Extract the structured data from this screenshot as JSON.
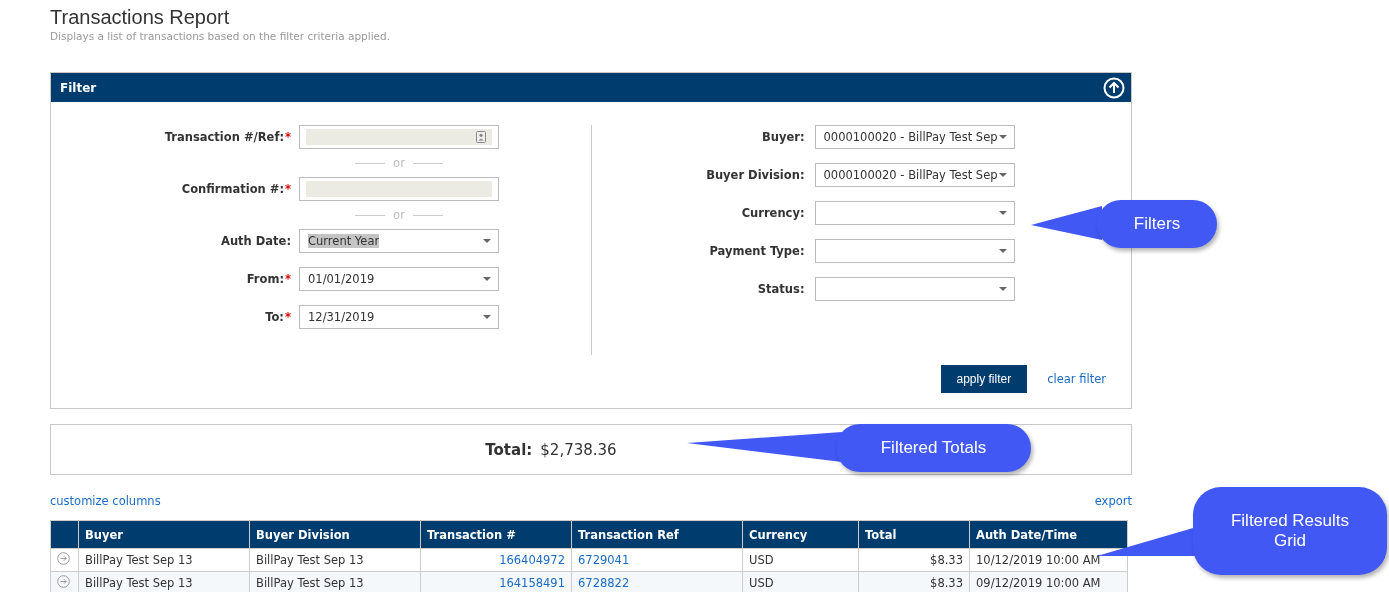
{
  "page": {
    "title": "Transactions Report",
    "subtitle": "Displays a list of transactions based on the filter criteria applied."
  },
  "filter": {
    "title": "Filter",
    "expanded": true,
    "left_fields": [
      {
        "kind": "text",
        "label": "Transaction #/Ref:",
        "required_mark": "*",
        "has_icon": true
      },
      {
        "kind": "separator",
        "text": "or"
      },
      {
        "kind": "text",
        "label": "Confirmation #:",
        "required_mark": "*",
        "has_icon": false
      },
      {
        "kind": "separator",
        "text": "or"
      },
      {
        "kind": "select",
        "label": "Auth Date:",
        "value": "Current Year",
        "highlighted": true
      },
      {
        "kind": "select",
        "label": "From:",
        "required_mark": "*",
        "value": "01/01/2019",
        "highlighted": false
      },
      {
        "kind": "select",
        "label": "To:",
        "required_mark": "*",
        "value": "12/31/2019",
        "highlighted": false
      }
    ],
    "right_fields": [
      {
        "kind": "select",
        "label": "Buyer:",
        "value": "0000100020 - BillPay Test Sep",
        "highlighted": false
      },
      {
        "kind": "select",
        "label": "Buyer Division:",
        "value": "0000100020 - BillPay Test Sep",
        "highlighted": false
      },
      {
        "kind": "select",
        "label": "Currency:",
        "highlighted": false
      },
      {
        "kind": "select",
        "label": "Payment Type:",
        "highlighted": false
      },
      {
        "kind": "select",
        "label": "Status:",
        "highlighted": false
      }
    ],
    "apply_button": "apply filter",
    "clear_link": "clear filter"
  },
  "totals": {
    "label": "Total:",
    "value": "$2,738.36"
  },
  "grid_links": {
    "customize": "customize columns",
    "export": "export"
  },
  "table": {
    "columns": [
      "Buyer",
      "Buyer Division",
      "Transaction #",
      "Transaction Ref",
      "Currency",
      "Total",
      "Auth Date/Time"
    ],
    "rows": [
      [
        "BillPay Test Sep 13",
        "BillPay Test Sep 13",
        "166404972",
        "6729041",
        "USD",
        "$8.33",
        "10/12/2019 10:00 AM"
      ],
      [
        "BillPay Test Sep 13",
        "BillPay Test Sep 13",
        "164158491",
        "6728822",
        "USD",
        "$8.33",
        "09/12/2019 10:00 AM"
      ]
    ]
  },
  "callouts": [
    {
      "text": "Filters"
    },
    {
      "text": "Filtered Totals"
    },
    {
      "text": "Filtered Results Grid"
    }
  ]
}
